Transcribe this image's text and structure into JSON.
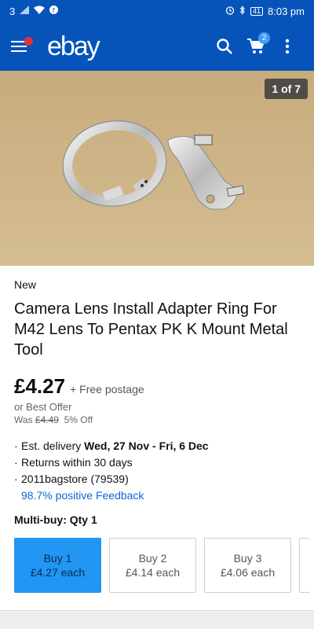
{
  "status_bar": {
    "carrier_signal": "3",
    "time": "8:03 pm",
    "battery": "41"
  },
  "app_bar": {
    "logo": "ebay",
    "cart_count": "2"
  },
  "gallery": {
    "counter": "1 of 7"
  },
  "listing": {
    "condition": "New",
    "title": "Camera Lens Install Adapter Ring For M42 Lens To Pentax PK K Mount Metal Tool",
    "price": "£4.27",
    "postage": "+ Free postage",
    "best_offer": "or Best Offer",
    "was_label": "Was",
    "was_price": "£4.49",
    "discount": "5% Off",
    "delivery_prefix": "Est. delivery",
    "delivery_dates": "Wed, 27 Nov - Fri, 6 Dec",
    "returns": "Returns within 30 days",
    "seller": "2011bagstore (79539)",
    "feedback": "98.7% positive Feedback",
    "multibuy_label": "Multi-buy: Qty 1"
  },
  "multibuy": [
    {
      "qty": "Buy 1",
      "price": "£4.27 each"
    },
    {
      "qty": "Buy 2",
      "price": "£4.14 each"
    },
    {
      "qty": "Buy 3",
      "price": "£4.06 each"
    }
  ],
  "colors": {
    "brand_blue": "#0654ba",
    "selected_card": "#2196f3",
    "link": "#0a68d6",
    "notification_dot": "#e53238"
  }
}
